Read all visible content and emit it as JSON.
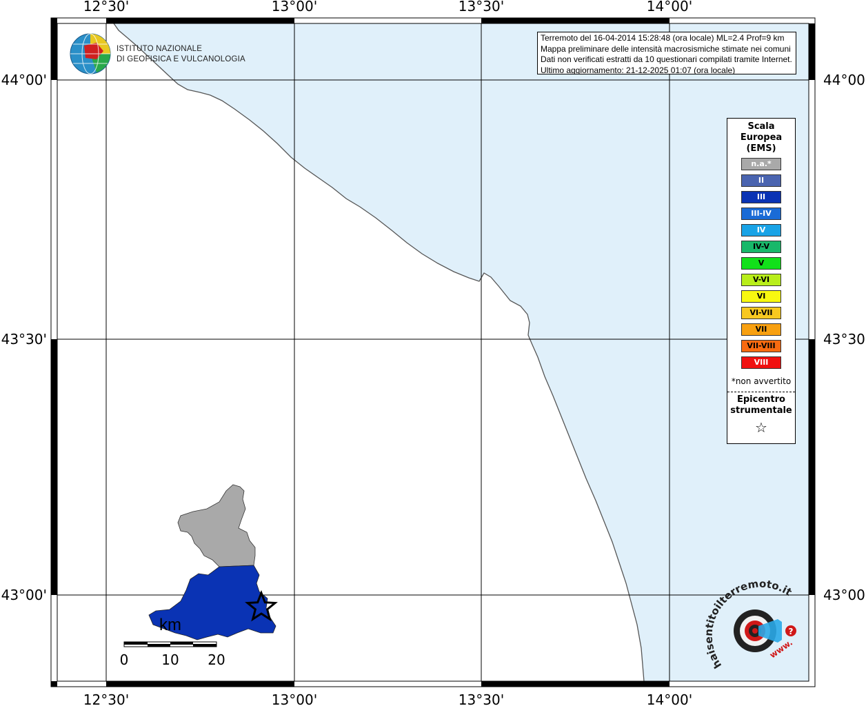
{
  "map": {
    "lon_labels": [
      "12°30'",
      "13°00'",
      "13°30'",
      "14°00'"
    ],
    "lat_labels": [
      "44°00'",
      "43°30'",
      "43°00'"
    ],
    "colors": {
      "sea": "#e0f0fa",
      "land": "#ffffff",
      "coast": "#555555",
      "grid": "#000000",
      "na_region": "#a9a9a9",
      "iii_region": "#0a33b4"
    }
  },
  "logo": {
    "line1": "ISTITUTO NAZIONALE",
    "line2": "DI GEOFISICA E VULCANOLOGIA"
  },
  "info": {
    "line1": "Terremoto del 16-04-2014 15:28:48 (ora locale) ML=2.4 Prof=9 km",
    "line2": "Mappa preliminare delle intensità macrosismiche stimate nei comuni",
    "line3": "Dati non verificati estratti da 10 questionari compilati tramite Internet.",
    "line4": "Ultimo aggiornamento: 21-12-2025 01:07 (ora locale)"
  },
  "legend": {
    "title1": "Scala",
    "title2": "Europea",
    "title3": "(EMS)",
    "items": [
      {
        "label": "n.a.*",
        "color": "#a9a9a9",
        "text": "#ffffff"
      },
      {
        "label": "II",
        "color": "#4a64b0",
        "text": "#ffffff"
      },
      {
        "label": "III",
        "color": "#0a33b4",
        "text": "#ffffff"
      },
      {
        "label": "III-IV",
        "color": "#1a6bd6",
        "text": "#ffffff"
      },
      {
        "label": "IV",
        "color": "#19a3e6",
        "text": "#ffffff"
      },
      {
        "label": "IV-V",
        "color": "#18b86a",
        "text": "#000000"
      },
      {
        "label": "V",
        "color": "#12e01a",
        "text": "#000000"
      },
      {
        "label": "V-VI",
        "color": "#b8ee1a",
        "text": "#000000"
      },
      {
        "label": "VI",
        "color": "#f8f810",
        "text": "#000000"
      },
      {
        "label": "VI-VII",
        "color": "#f8c820",
        "text": "#000000"
      },
      {
        "label": "VII",
        "color": "#f8a010",
        "text": "#000000"
      },
      {
        "label": "VII-VIII",
        "color": "#f86a10",
        "text": "#000000"
      },
      {
        "label": "VIII",
        "color": "#f01010",
        "text": "#ffffff"
      }
    ],
    "note": "*non avvertito",
    "epi1": "Epicentro",
    "epi2": "strumentale",
    "star": "☆"
  },
  "scale": {
    "unit": "km",
    "ticks": [
      "0",
      "10",
      "20"
    ]
  },
  "hsit": {
    "text": "haisentitoilterremoto.it",
    "www": "www."
  }
}
